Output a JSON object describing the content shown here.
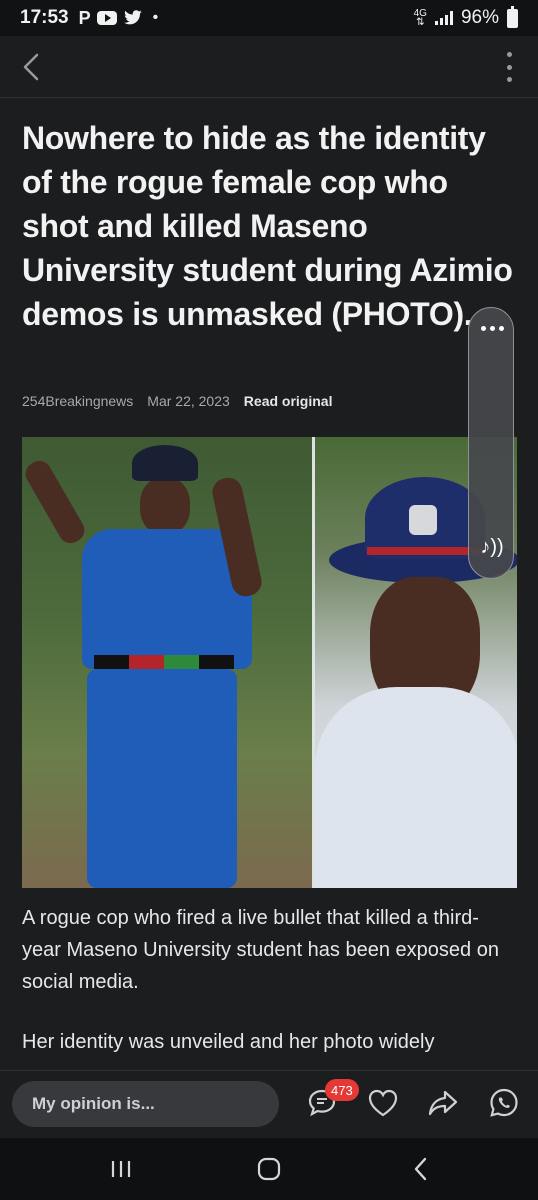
{
  "status_bar": {
    "time": "17:53",
    "app_p": "P",
    "network": "4G",
    "battery": "96%"
  },
  "article": {
    "title": "Nowhere to hide as the identity of the rogue female cop who shot and killed Maseno University student during Azimio demos is unmasked (PHOTO).",
    "source": "254Breakingnews",
    "date": "Mar 22, 2023",
    "read_original": "Read original",
    "paragraphs": [
      "A rogue cop who fired a live bullet that killed a third-year Maseno University student has been exposed on social media.",
      "Her identity was unveiled and her photo widely"
    ]
  },
  "action_bar": {
    "opinion_placeholder": "My opinion is...",
    "comment_count": "473"
  },
  "colors": {
    "background": "#1c1d1f",
    "badge_red": "#e53935",
    "uniform_blue": "#1f5db8"
  },
  "icons": [
    "back-chevron-icon",
    "more-vertical-icon",
    "audio-play-icon",
    "comment-icon",
    "heart-icon",
    "share-icon",
    "whatsapp-icon",
    "nav-recents-icon",
    "nav-home-icon",
    "nav-back-icon"
  ]
}
